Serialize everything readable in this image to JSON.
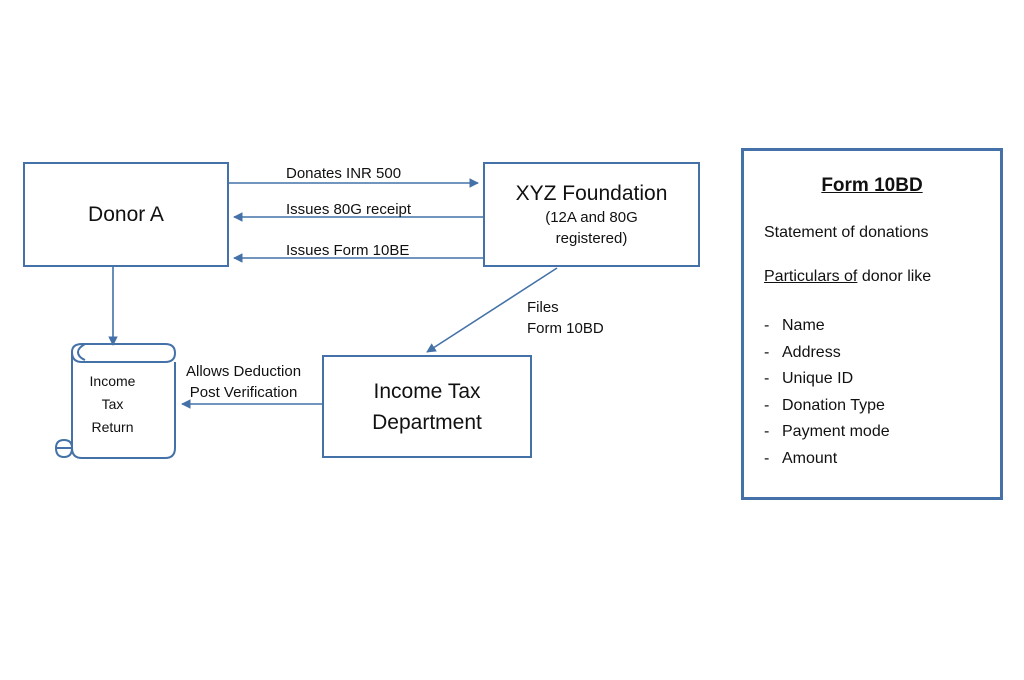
{
  "diagram": {
    "nodes": {
      "donor": {
        "title": "Donor A"
      },
      "foundation": {
        "title": "XYZ Foundation",
        "subtitle_line1": "(12A and 80G",
        "subtitle_line2": "registered)"
      },
      "department": {
        "title_line1": "Income Tax",
        "title_line2": "Department"
      },
      "return_scroll": {
        "line1": "Income",
        "line2": "Tax",
        "line3": "Return"
      }
    },
    "edges": {
      "donates": "Donates INR 500",
      "receipt": "Issues 80G receipt",
      "form10be": "Issues Form 10BE",
      "files_line1": "Files",
      "files_line2": "Form 10BD",
      "allows_line1": "Allows Deduction",
      "allows_line2": "Post Verification"
    },
    "colors": {
      "stroke": "#4472a8",
      "text": "#111111",
      "background": "#ffffff"
    }
  },
  "form_panel": {
    "title": "Form 10BD",
    "statement": "Statement of donations",
    "particulars_underlined": "Particulars of",
    "particulars_rest": " donor like",
    "items": [
      "Name",
      "Address",
      "Unique ID",
      "Donation Type",
      "Payment mode",
      "Amount"
    ],
    "dash": "-"
  }
}
